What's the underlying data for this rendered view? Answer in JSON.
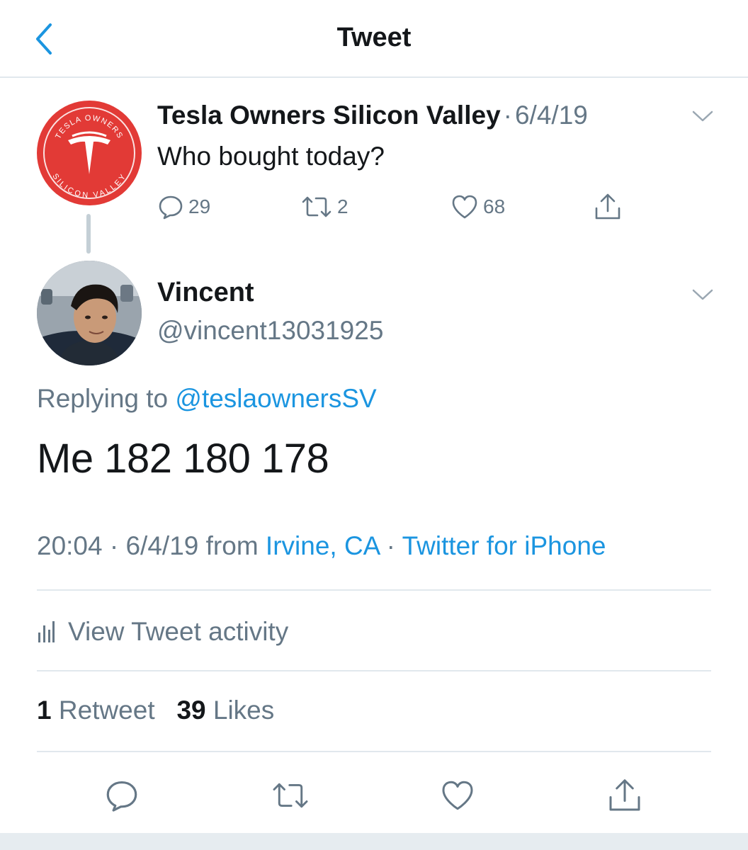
{
  "header": {
    "title": "Tweet"
  },
  "parent_tweet": {
    "avatar_text_top": "TESLA OWNERS",
    "avatar_text_bottom": "SILICON VALLEY",
    "name": "Tesla Owners Silicon Valley",
    "separator": "·",
    "date": "6/4/19",
    "text": "Who bought today?",
    "replies": "29",
    "retweets": "2",
    "likes": "68"
  },
  "main_tweet": {
    "name": "Vincent",
    "handle": "@vincent13031925",
    "replying_prefix": "Replying to",
    "replying_handle": "@teslaownersSV",
    "text": "Me 182 180 178",
    "time": "20:04",
    "dot": "·",
    "date": "6/4/19",
    "from_word": "from",
    "location": "Irvine, CA",
    "source": "Twitter for iPhone"
  },
  "activity": {
    "label": "View Tweet activity"
  },
  "stats": {
    "retweet_count": "1",
    "retweet_label": "Retweet",
    "like_count": "39",
    "like_label": "Likes"
  },
  "colors": {
    "accent": "#1b95e0",
    "secondary_text": "#657786",
    "primary_text": "#14171a",
    "tesla_red": "#e23a36",
    "divider": "#e1e8ed"
  },
  "icons": {
    "back": "chevron-left-icon",
    "caret": "chevron-down-icon",
    "reply": "reply-icon",
    "retweet": "retweet-icon",
    "like": "heart-icon",
    "share": "share-icon",
    "activity": "bar-chart-icon"
  }
}
